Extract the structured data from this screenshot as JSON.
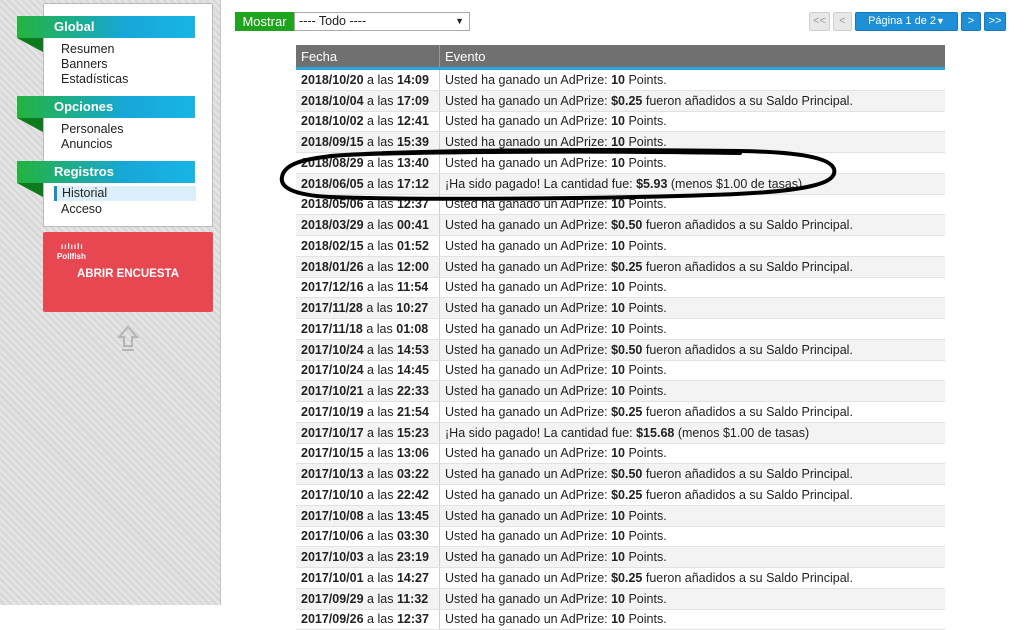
{
  "sidebar": {
    "sections": [
      {
        "title": "Global",
        "items": [
          "Resumen",
          "Banners",
          "Estadísticas"
        ]
      },
      {
        "title": "Opciones",
        "items": [
          "Personales",
          "Anuncios"
        ]
      },
      {
        "title": "Registros",
        "items": [
          "Historial",
          "Acceso"
        ]
      }
    ],
    "active_item": "Historial",
    "ad": {
      "brand": "Pollfish",
      "cta": "ABRIR ENCUESTA"
    },
    "scroll_top_icon": "arrow-up-icon"
  },
  "toolbar": {
    "show_label": "Mostrar",
    "filter_value": "---- Todo ----",
    "pagination": {
      "first": "<<",
      "prev": "<",
      "page_label": "Página 1 de 2",
      "next": ">",
      "last": ">>"
    }
  },
  "table": {
    "headers": [
      "Fecha",
      "Evento"
    ],
    "connector": "a las",
    "rows": [
      {
        "date": "2018/10/20",
        "time": "14:09",
        "pre": "Usted ha ganado un AdPrize: ",
        "amount": "10",
        "post": " Points."
      },
      {
        "date": "2018/10/04",
        "time": "17:09",
        "pre": "Usted ha ganado un AdPrize: ",
        "amount": "$0.25",
        "post": " fueron añadidos a su Saldo Principal."
      },
      {
        "date": "2018/10/02",
        "time": "12:41",
        "pre": "Usted ha ganado un AdPrize: ",
        "amount": "10",
        "post": " Points."
      },
      {
        "date": "2018/09/15",
        "time": "15:39",
        "pre": "Usted ha ganado un AdPrize: ",
        "amount": "10",
        "post": " Points."
      },
      {
        "date": "2018/08/29",
        "time": "13:40",
        "pre": "Usted ha ganado un AdPrize: ",
        "amount": "10",
        "post": " Points."
      },
      {
        "date": "2018/06/05",
        "time": "17:12",
        "pre": "¡Ha sido pagado! La cantidad fue: ",
        "amount": "$5.93",
        "post": " (menos $1.00 de tasas)"
      },
      {
        "date": "2018/05/06",
        "time": "12:37",
        "pre": "Usted ha ganado un AdPrize: ",
        "amount": "10",
        "post": " Points."
      },
      {
        "date": "2018/03/29",
        "time": "00:41",
        "pre": "Usted ha ganado un AdPrize: ",
        "amount": "$0.50",
        "post": " fueron añadidos a su Saldo Principal."
      },
      {
        "date": "2018/02/15",
        "time": "01:52",
        "pre": "Usted ha ganado un AdPrize: ",
        "amount": "10",
        "post": " Points."
      },
      {
        "date": "2018/01/26",
        "time": "12:00",
        "pre": "Usted ha ganado un AdPrize: ",
        "amount": "$0.25",
        "post": " fueron añadidos a su Saldo Principal."
      },
      {
        "date": "2017/12/16",
        "time": "11:54",
        "pre": "Usted ha ganado un AdPrize: ",
        "amount": "10",
        "post": " Points."
      },
      {
        "date": "2017/11/28",
        "time": "10:27",
        "pre": "Usted ha ganado un AdPrize: ",
        "amount": "10",
        "post": " Points."
      },
      {
        "date": "2017/11/18",
        "time": "01:08",
        "pre": "Usted ha ganado un AdPrize: ",
        "amount": "10",
        "post": " Points."
      },
      {
        "date": "2017/10/24",
        "time": "14:53",
        "pre": "Usted ha ganado un AdPrize: ",
        "amount": "$0.50",
        "post": " fueron añadidos a su Saldo Principal."
      },
      {
        "date": "2017/10/24",
        "time": "14:45",
        "pre": "Usted ha ganado un AdPrize: ",
        "amount": "10",
        "post": " Points."
      },
      {
        "date": "2017/10/21",
        "time": "22:33",
        "pre": "Usted ha ganado un AdPrize: ",
        "amount": "10",
        "post": " Points."
      },
      {
        "date": "2017/10/19",
        "time": "21:54",
        "pre": "Usted ha ganado un AdPrize: ",
        "amount": "$0.25",
        "post": " fueron añadidos a su Saldo Principal."
      },
      {
        "date": "2017/10/17",
        "time": "15:23",
        "pre": "¡Ha sido pagado! La cantidad fue: ",
        "amount": "$15.68",
        "post": " (menos $1.00 de tasas)"
      },
      {
        "date": "2017/10/15",
        "time": "13:06",
        "pre": "Usted ha ganado un AdPrize: ",
        "amount": "10",
        "post": " Points."
      },
      {
        "date": "2017/10/13",
        "time": "03:22",
        "pre": "Usted ha ganado un AdPrize: ",
        "amount": "$0.50",
        "post": " fueron añadidos a su Saldo Principal."
      },
      {
        "date": "2017/10/10",
        "time": "22:42",
        "pre": "Usted ha ganado un AdPrize: ",
        "amount": "$0.25",
        "post": " fueron añadidos a su Saldo Principal."
      },
      {
        "date": "2017/10/08",
        "time": "13:45",
        "pre": "Usted ha ganado un AdPrize: ",
        "amount": "10",
        "post": " Points."
      },
      {
        "date": "2017/10/06",
        "time": "03:30",
        "pre": "Usted ha ganado un AdPrize: ",
        "amount": "10",
        "post": " Points."
      },
      {
        "date": "2017/10/03",
        "time": "23:19",
        "pre": "Usted ha ganado un AdPrize: ",
        "amount": "10",
        "post": " Points."
      },
      {
        "date": "2017/10/01",
        "time": "14:27",
        "pre": "Usted ha ganado un AdPrize: ",
        "amount": "$0.25",
        "post": " fueron añadidos a su Saldo Principal."
      },
      {
        "date": "2017/09/29",
        "time": "11:32",
        "pre": "Usted ha ganado un AdPrize: ",
        "amount": "10",
        "post": " Points."
      },
      {
        "date": "2017/09/26",
        "time": "12:37",
        "pre": "Usted ha ganado un AdPrize: ",
        "amount": "10",
        "post": " Points."
      }
    ]
  },
  "colors": {
    "accent_green": "#1fa41f",
    "accent_blue": "#1e90d8",
    "header_gray": "#707070",
    "ad_red": "#e64750"
  }
}
